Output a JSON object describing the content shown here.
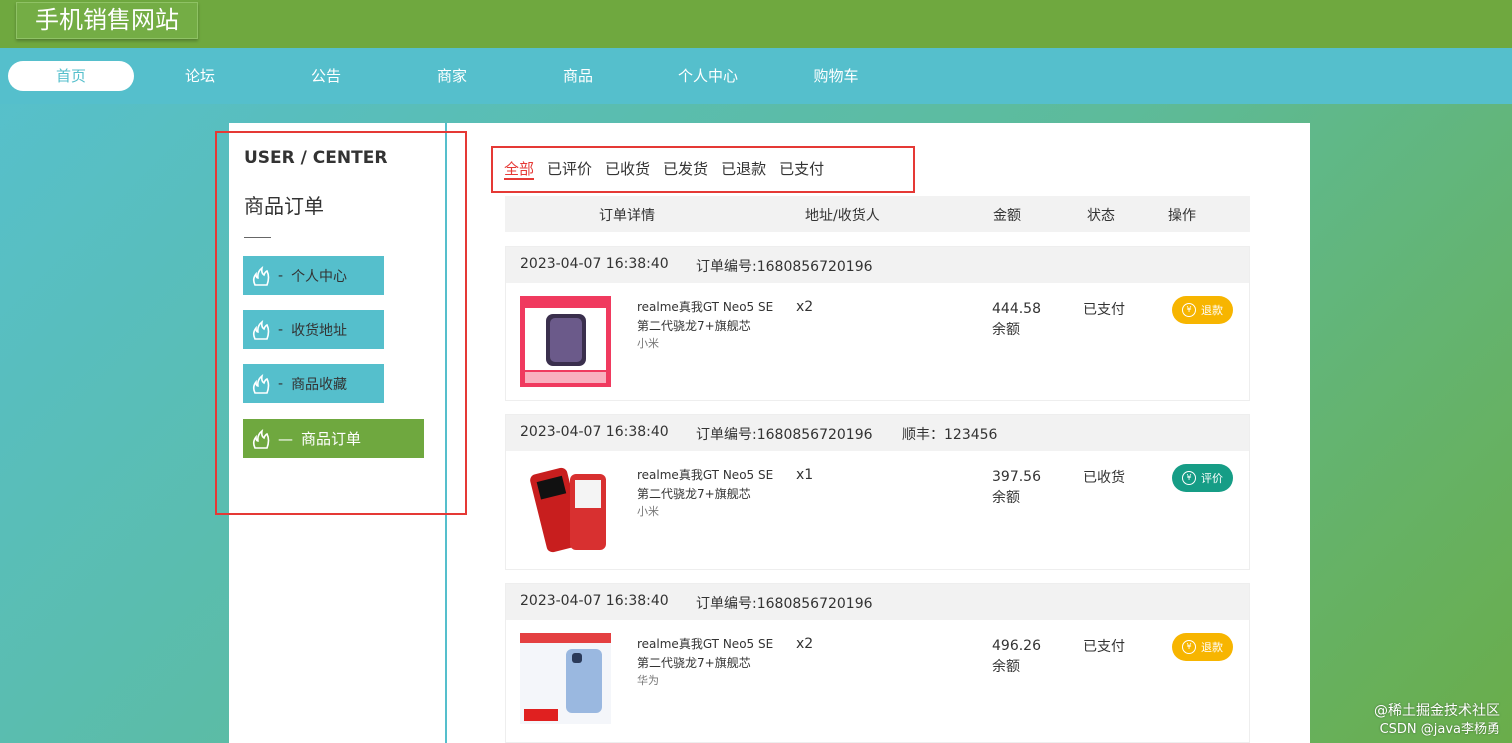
{
  "site": {
    "title": "手机销售网站"
  },
  "nav": {
    "items": [
      {
        "label": "首页",
        "active": true
      },
      {
        "label": "论坛"
      },
      {
        "label": "公告"
      },
      {
        "label": "商家"
      },
      {
        "label": "商品"
      },
      {
        "label": "个人中心"
      },
      {
        "label": "购物车"
      }
    ]
  },
  "sidebar": {
    "heading": "USER / CENTER",
    "section_title": "商品订单",
    "items": [
      {
        "label": "个人中心"
      },
      {
        "label": "收货地址"
      },
      {
        "label": "商品收藏"
      },
      {
        "label": "商品订单",
        "active": true
      }
    ],
    "item_separator": "-",
    "active_separator": "—"
  },
  "tabs": [
    {
      "label": "全部",
      "active": true
    },
    {
      "label": "已评价"
    },
    {
      "label": "已收货"
    },
    {
      "label": "已发货"
    },
    {
      "label": "已退款"
    },
    {
      "label": "已支付"
    }
  ],
  "table": {
    "headers": [
      "订单详情",
      "地址/收货人",
      "金额",
      "状态",
      "操作"
    ]
  },
  "orders": [
    {
      "time": "2023-04-07 16:38:40",
      "order_no": "订单编号:1680856720196",
      "shipping": "",
      "product": "realme真我GT Neo5 SE 第二代骁龙7+旗舰芯",
      "brand": "小米",
      "qty": "x2",
      "amount": "444.58",
      "pay": "余额",
      "status": "已支付",
      "action": "退款",
      "action_color": "#f7b500"
    },
    {
      "time": "2023-04-07 16:38:40",
      "order_no": "订单编号:1680856720196",
      "shipping": "顺丰：123456",
      "product": "realme真我GT Neo5 SE 第二代骁龙7+旗舰芯",
      "brand": "小米",
      "qty": "x1",
      "amount": "397.56",
      "pay": "余额",
      "status": "已收货",
      "action": "评价",
      "action_color": "#169d86"
    },
    {
      "time": "2023-04-07 16:38:40",
      "order_no": "订单编号:1680856720196",
      "shipping": "",
      "product": "realme真我GT Neo5 SE 第二代骁龙7+旗舰芯",
      "brand": "华为",
      "qty": "x2",
      "amount": "496.26",
      "pay": "余额",
      "status": "已支付",
      "action": "退款",
      "action_color": "#f7b500"
    }
  ],
  "watermark": {
    "line1": "@稀土掘金技术社区",
    "line2": "CSDN @java李杨勇"
  },
  "colors": {
    "nav": "#55bfcc",
    "topbar": "#6fa83f",
    "accent_red": "#e53935"
  }
}
